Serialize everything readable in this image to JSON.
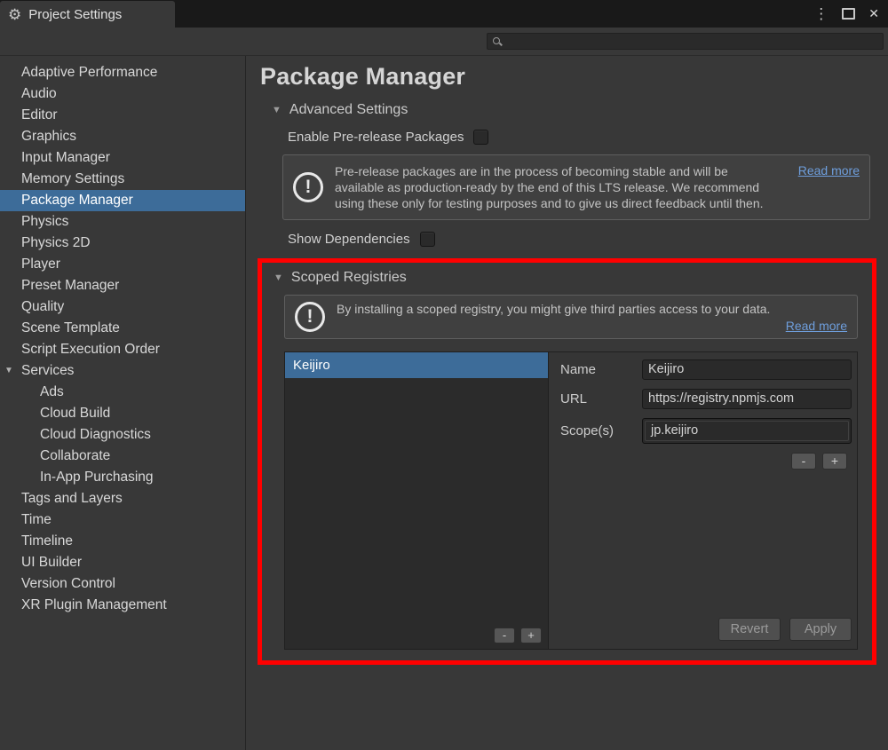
{
  "window": {
    "title": "Project Settings"
  },
  "icons": {
    "gear": "⚙",
    "menu": "⋮",
    "close": "✕",
    "foldout_open": "▼",
    "info": "!"
  },
  "sidebar": {
    "items": [
      {
        "label": "Adaptive Performance"
      },
      {
        "label": "Audio"
      },
      {
        "label": "Editor"
      },
      {
        "label": "Graphics"
      },
      {
        "label": "Input Manager"
      },
      {
        "label": "Memory Settings"
      },
      {
        "label": "Package Manager",
        "selected": true
      },
      {
        "label": "Physics"
      },
      {
        "label": "Physics 2D"
      },
      {
        "label": "Player"
      },
      {
        "label": "Preset Manager"
      },
      {
        "label": "Quality"
      },
      {
        "label": "Scene Template"
      },
      {
        "label": "Script Execution Order"
      },
      {
        "label": "Services",
        "expandable": true
      },
      {
        "label": "Ads",
        "indent": 1
      },
      {
        "label": "Cloud Build",
        "indent": 1
      },
      {
        "label": "Cloud Diagnostics",
        "indent": 1
      },
      {
        "label": "Collaborate",
        "indent": 1
      },
      {
        "label": "In-App Purchasing",
        "indent": 1
      },
      {
        "label": "Tags and Layers"
      },
      {
        "label": "Time"
      },
      {
        "label": "Timeline"
      },
      {
        "label": "UI Builder"
      },
      {
        "label": "Version Control"
      },
      {
        "label": "XR Plugin Management"
      }
    ]
  },
  "main": {
    "title": "Package Manager",
    "advanced": {
      "section_title": "Advanced Settings",
      "enable_prerelease_label": "Enable Pre-release Packages",
      "enable_prerelease_checked": false,
      "info_text": "Pre-release packages are in the process of becoming stable and will be available as production-ready by the end of this LTS release. We recommend using these only for testing purposes and to give us direct feedback until then.",
      "read_more_label": "Read more",
      "show_dependencies_label": "Show Dependencies",
      "show_dependencies_checked": false
    },
    "scoped": {
      "section_title": "Scoped Registries",
      "info_text": "By installing a scoped registry, you might give third parties access to your data.",
      "read_more_label": "Read more",
      "registries": [
        {
          "name": "Keijiro",
          "selected": true
        }
      ],
      "form": {
        "name_label": "Name",
        "name_value": "Keijiro",
        "url_label": "URL",
        "url_value": "https://registry.npmjs.com",
        "scopes_label": "Scope(s)",
        "scopes": [
          "jp.keijiro"
        ]
      },
      "buttons": {
        "remove": "-",
        "add": "+",
        "revert": "Revert",
        "apply": "Apply"
      }
    }
  },
  "annotation": {
    "highlight_color": "#FF0000"
  }
}
